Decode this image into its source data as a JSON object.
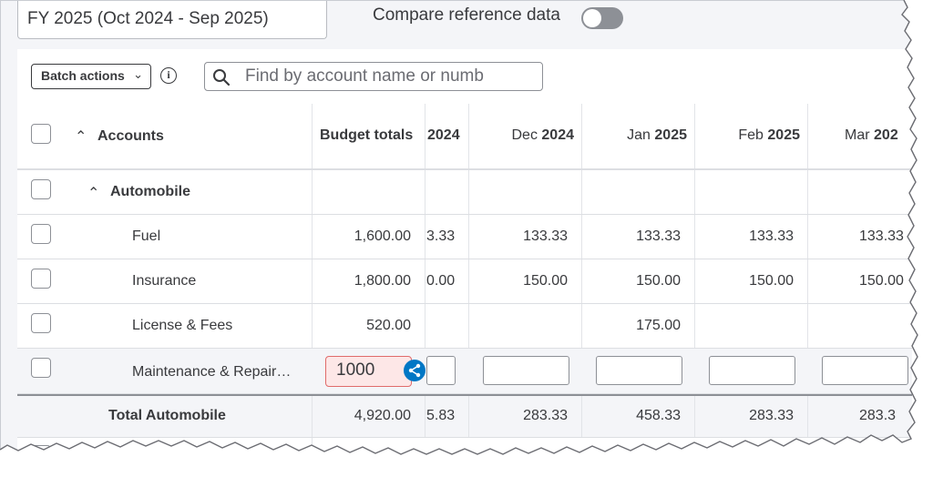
{
  "header": {
    "fiscal_year": "FY 2025 (Oct 2024 - Sep 2025)",
    "compare_label": "Compare reference data",
    "compare_enabled": false
  },
  "toolbar": {
    "batch_actions": "Batch actions",
    "search_placeholder": "Find by account name or numb"
  },
  "table": {
    "columns": {
      "accounts": "Accounts",
      "budget_totals": "Budget totals",
      "nov_partial": "2024",
      "dec_month": "Dec",
      "dec_year": "2024",
      "jan_month": "Jan",
      "jan_year": "2025",
      "feb_month": "Feb",
      "feb_year": "2025",
      "mar_month": "Mar",
      "mar_year": "202"
    },
    "group": {
      "name": "Automobile"
    },
    "rows": [
      {
        "name": "Fuel",
        "total": "1,600.00",
        "nov": "3.33",
        "dec": "133.33",
        "jan": "133.33",
        "feb": "133.33",
        "mar": "133.33"
      },
      {
        "name": "Insurance",
        "total": "1,800.00",
        "nov": "0.00",
        "dec": "150.00",
        "jan": "150.00",
        "feb": "150.00",
        "mar": "150.00"
      },
      {
        "name": "License & Fees",
        "total": "520.00",
        "nov": "",
        "dec": "",
        "jan": "175.00",
        "feb": "",
        "mar": ""
      }
    ],
    "editing_row": {
      "name": "Maintenance & Repair…",
      "total_input": "1000"
    },
    "total_row": {
      "label": "Total Automobile",
      "total": "4,920.00",
      "nov": "5.83",
      "dec": "283.33",
      "jan": "458.33",
      "feb": "283.33",
      "mar": "283.3"
    }
  },
  "colors": {
    "accent": "#0077c5",
    "error_fill": "#fde7e7",
    "error_border": "#e06b6b"
  }
}
